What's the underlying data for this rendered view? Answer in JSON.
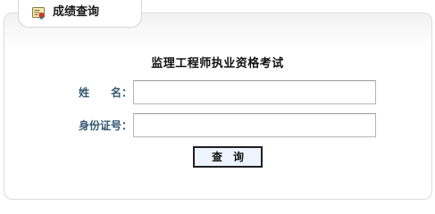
{
  "tab": {
    "title": "成绩查询",
    "icon": "certificate-icon"
  },
  "form": {
    "title": "监理工程师执业资格考试",
    "name_label": "姓　　名：",
    "name_value": "",
    "id_label": "身份证号：",
    "id_value": "",
    "submit_label": "查　询"
  },
  "colors": {
    "label": "#335870",
    "button_bg": "#eef4ff",
    "button_border": "#1f1f1f",
    "panel_border": "#dcdcdc"
  }
}
